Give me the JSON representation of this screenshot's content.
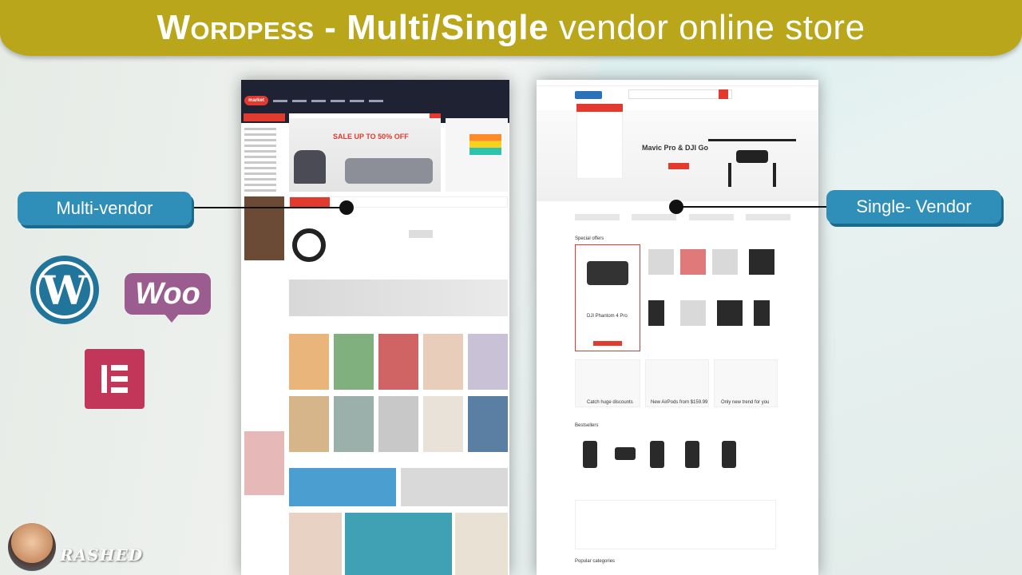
{
  "banner": {
    "part1": "Wordpess -",
    "part2": "Multi/Single",
    "part3": "vendor online store"
  },
  "labels": {
    "multi_vendor": "Multi-vendor",
    "single_vendor": "Single- Vendor"
  },
  "logos": {
    "wordpress": "W",
    "woocommerce": "Woo",
    "elementor": "elementor-icon"
  },
  "signature": "RASHED",
  "multi_vendor_shot": {
    "logo": "market",
    "hero_sale": "SALE UP TO 50% OFF"
  },
  "single_vendor_shot": {
    "hero_title": "Mavic Pro & DJI Go",
    "special_offers": "Special offers",
    "featured_product": "DJI Phantom 4 Pro",
    "bestsellers": "Bestsellers",
    "popular_categories": "Popular categories",
    "promo1": "Catch huge discounts",
    "promo2": "New AirPods from $159.99",
    "promo3": "Only new trend for you"
  },
  "colors": {
    "banner": "#b9a61a",
    "pill": "#2f8fb8",
    "accent_red": "#e03b2e",
    "wordpress": "#21759b",
    "woo": "#9b5c8f",
    "elementor": "#c2365a"
  }
}
